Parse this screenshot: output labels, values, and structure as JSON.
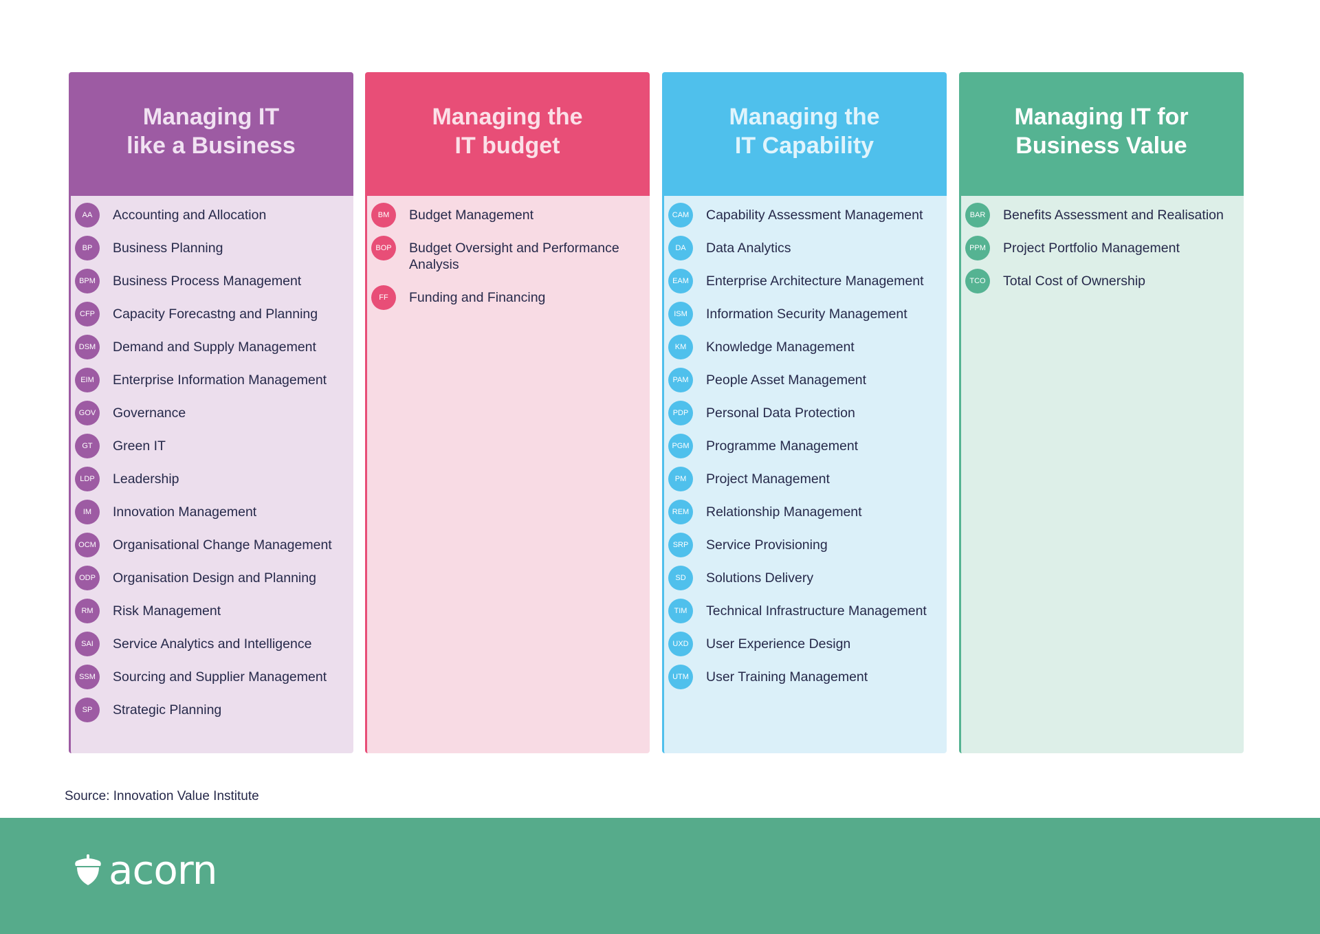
{
  "columns": [
    {
      "title": "Managing IT\nlike a Business",
      "color": "#9d5ba3",
      "title_color": "#f1e2f2",
      "body_bg": "#ecdeed",
      "items": [
        {
          "code": "AA",
          "label": "Accounting and Allocation"
        },
        {
          "code": "BP",
          "label": "Business Planning"
        },
        {
          "code": "BPM",
          "label": "Business Process Management"
        },
        {
          "code": "CFP",
          "label": "Capacity Forecastng and Planning"
        },
        {
          "code": "DSM",
          "label": "Demand and Supply Management"
        },
        {
          "code": "EIM",
          "label": "Enterprise Information Management"
        },
        {
          "code": "GOV",
          "label": "Governance"
        },
        {
          "code": "GT",
          "label": "Green IT"
        },
        {
          "code": "LDP",
          "label": "Leadership"
        },
        {
          "code": "IM",
          "label": "Innovation Management"
        },
        {
          "code": "OCM",
          "label": "Organisational Change Management"
        },
        {
          "code": "ODP",
          "label": "Organisation Design and Planning"
        },
        {
          "code": "RM",
          "label": "Risk Management"
        },
        {
          "code": "SAI",
          "label": "Service Analytics and Intelligence"
        },
        {
          "code": "SSM",
          "label": "Sourcing and Supplier Management"
        },
        {
          "code": "SP",
          "label": "Strategic Planning"
        }
      ]
    },
    {
      "title": "Managing the\nIT budget",
      "color": "#e84e77",
      "title_color": "#fbe0e8",
      "body_bg": "#f8dbe4",
      "items": [
        {
          "code": "BM",
          "label": "Budget Management"
        },
        {
          "code": "BOP",
          "label": "Budget Oversight and Performance Analysis"
        },
        {
          "code": "FF",
          "label": "Funding and Financing"
        }
      ]
    },
    {
      "title": "Managing the\nIT Capability",
      "color": "#4fc0ec",
      "title_color": "#e0f4fc",
      "body_bg": "#dbf0f9",
      "items": [
        {
          "code": "CAM",
          "label": "Capability Assessment Management"
        },
        {
          "code": "DA",
          "label": "Data Analytics"
        },
        {
          "code": "EAM",
          "label": "Enterprise Architecture Management"
        },
        {
          "code": "ISM",
          "label": "Information Security Management"
        },
        {
          "code": "KM",
          "label": "Knowledge Management"
        },
        {
          "code": "PAM",
          "label": "People Asset Management"
        },
        {
          "code": "PDP",
          "label": "Personal Data Protection"
        },
        {
          "code": "PGM",
          "label": "Programme Management"
        },
        {
          "code": "PM",
          "label": "Project Management"
        },
        {
          "code": "REM",
          "label": "Relationship Management"
        },
        {
          "code": "SRP",
          "label": "Service Provisioning"
        },
        {
          "code": "SD",
          "label": "Solutions Delivery"
        },
        {
          "code": "TIM",
          "label": "Technical Infrastructure Management"
        },
        {
          "code": "UXD",
          "label": "User Experience Design"
        },
        {
          "code": "UTM",
          "label": "User Training Management"
        }
      ]
    },
    {
      "title": "Managing IT for\nBusiness Value",
      "color": "#55b392",
      "title_color": "#ffffff",
      "body_bg": "#ddefe8",
      "items": [
        {
          "code": "BAR",
          "label": "Benefits Assessment and Realisation"
        },
        {
          "code": "PPM",
          "label": "Project Portfolio Management"
        },
        {
          "code": "TCO",
          "label": "Total Cost of Ownership"
        }
      ]
    }
  ],
  "source": "Source: Innovation Value Institute",
  "footer": {
    "logo_text": "acorn",
    "logo_icon": "acorn-icon",
    "bg_color": "#56ab8b"
  }
}
